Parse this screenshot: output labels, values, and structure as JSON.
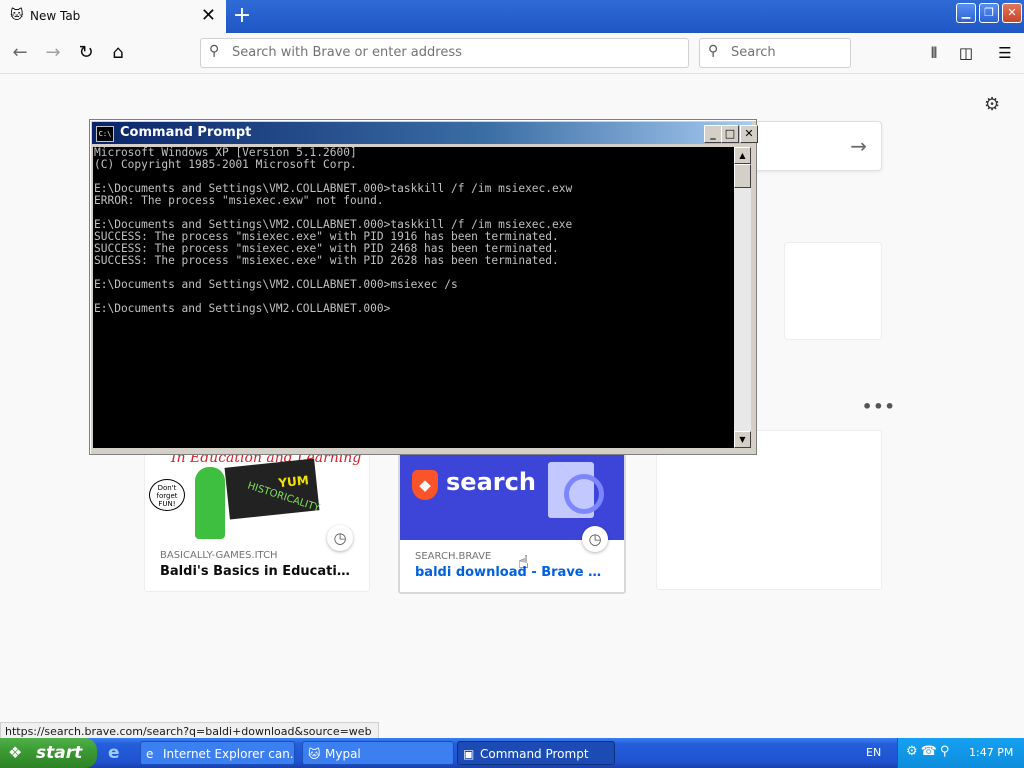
{
  "browser": {
    "tab_title": "New Tab",
    "tab_close": "✕",
    "new_tab": "+",
    "url_placeholder": "Search with Brave or enter address",
    "search_placeholder": "Search"
  },
  "newtab_page": {
    "cards": [
      {
        "source": "BASICALLY-GAMES.ITCH",
        "title": "Baldi's Basics in Education a...",
        "thumb_headline": "In Education and Learning",
        "thumb_word": "YUM",
        "thumb_scrawl": "HISTORICALITY",
        "thumb_bubble": "Don't forget FUN!"
      },
      {
        "source": "SEARCH.BRAVE",
        "title": "baldi download - Brave Sear...",
        "thumb_word": "search"
      }
    ]
  },
  "cmd_window": {
    "title": "Command Prompt",
    "icon_text": "C:\\",
    "lines": [
      "Microsoft Windows XP [Version 5.1.2600]",
      "(C) Copyright 1985-2001 Microsoft Corp.",
      "",
      "E:\\Documents and Settings\\VM2.COLLABNET.000>taskkill /f /im msiexec.exw",
      "ERROR: The process \"msiexec.exw\" not found.",
      "",
      "E:\\Documents and Settings\\VM2.COLLABNET.000>taskkill /f /im msiexec.exe",
      "SUCCESS: The process \"msiexec.exe\" with PID 1916 has been terminated.",
      "SUCCESS: The process \"msiexec.exe\" with PID 2468 has been terminated.",
      "SUCCESS: The process \"msiexec.exe\" with PID 2628 has been terminated.",
      "",
      "E:\\Documents and Settings\\VM2.COLLABNET.000>msiexec /s",
      "",
      "E:\\Documents and Settings\\VM2.COLLABNET.000>"
    ]
  },
  "status_url": "https://search.brave.com/search?q=baldi+download&source=web",
  "taskbar": {
    "start_label": "start",
    "tasks": [
      {
        "label": "Internet Explorer can..."
      },
      {
        "label": "Mypal"
      },
      {
        "label": "Command Prompt"
      }
    ],
    "language": "EN",
    "clock": "1:47 PM"
  },
  "colors": {
    "xp_title_blue": "#0a246a",
    "taskbar_blue": "#245edb",
    "start_green": "#3c9b34",
    "brave_orange": "#fb542b"
  }
}
